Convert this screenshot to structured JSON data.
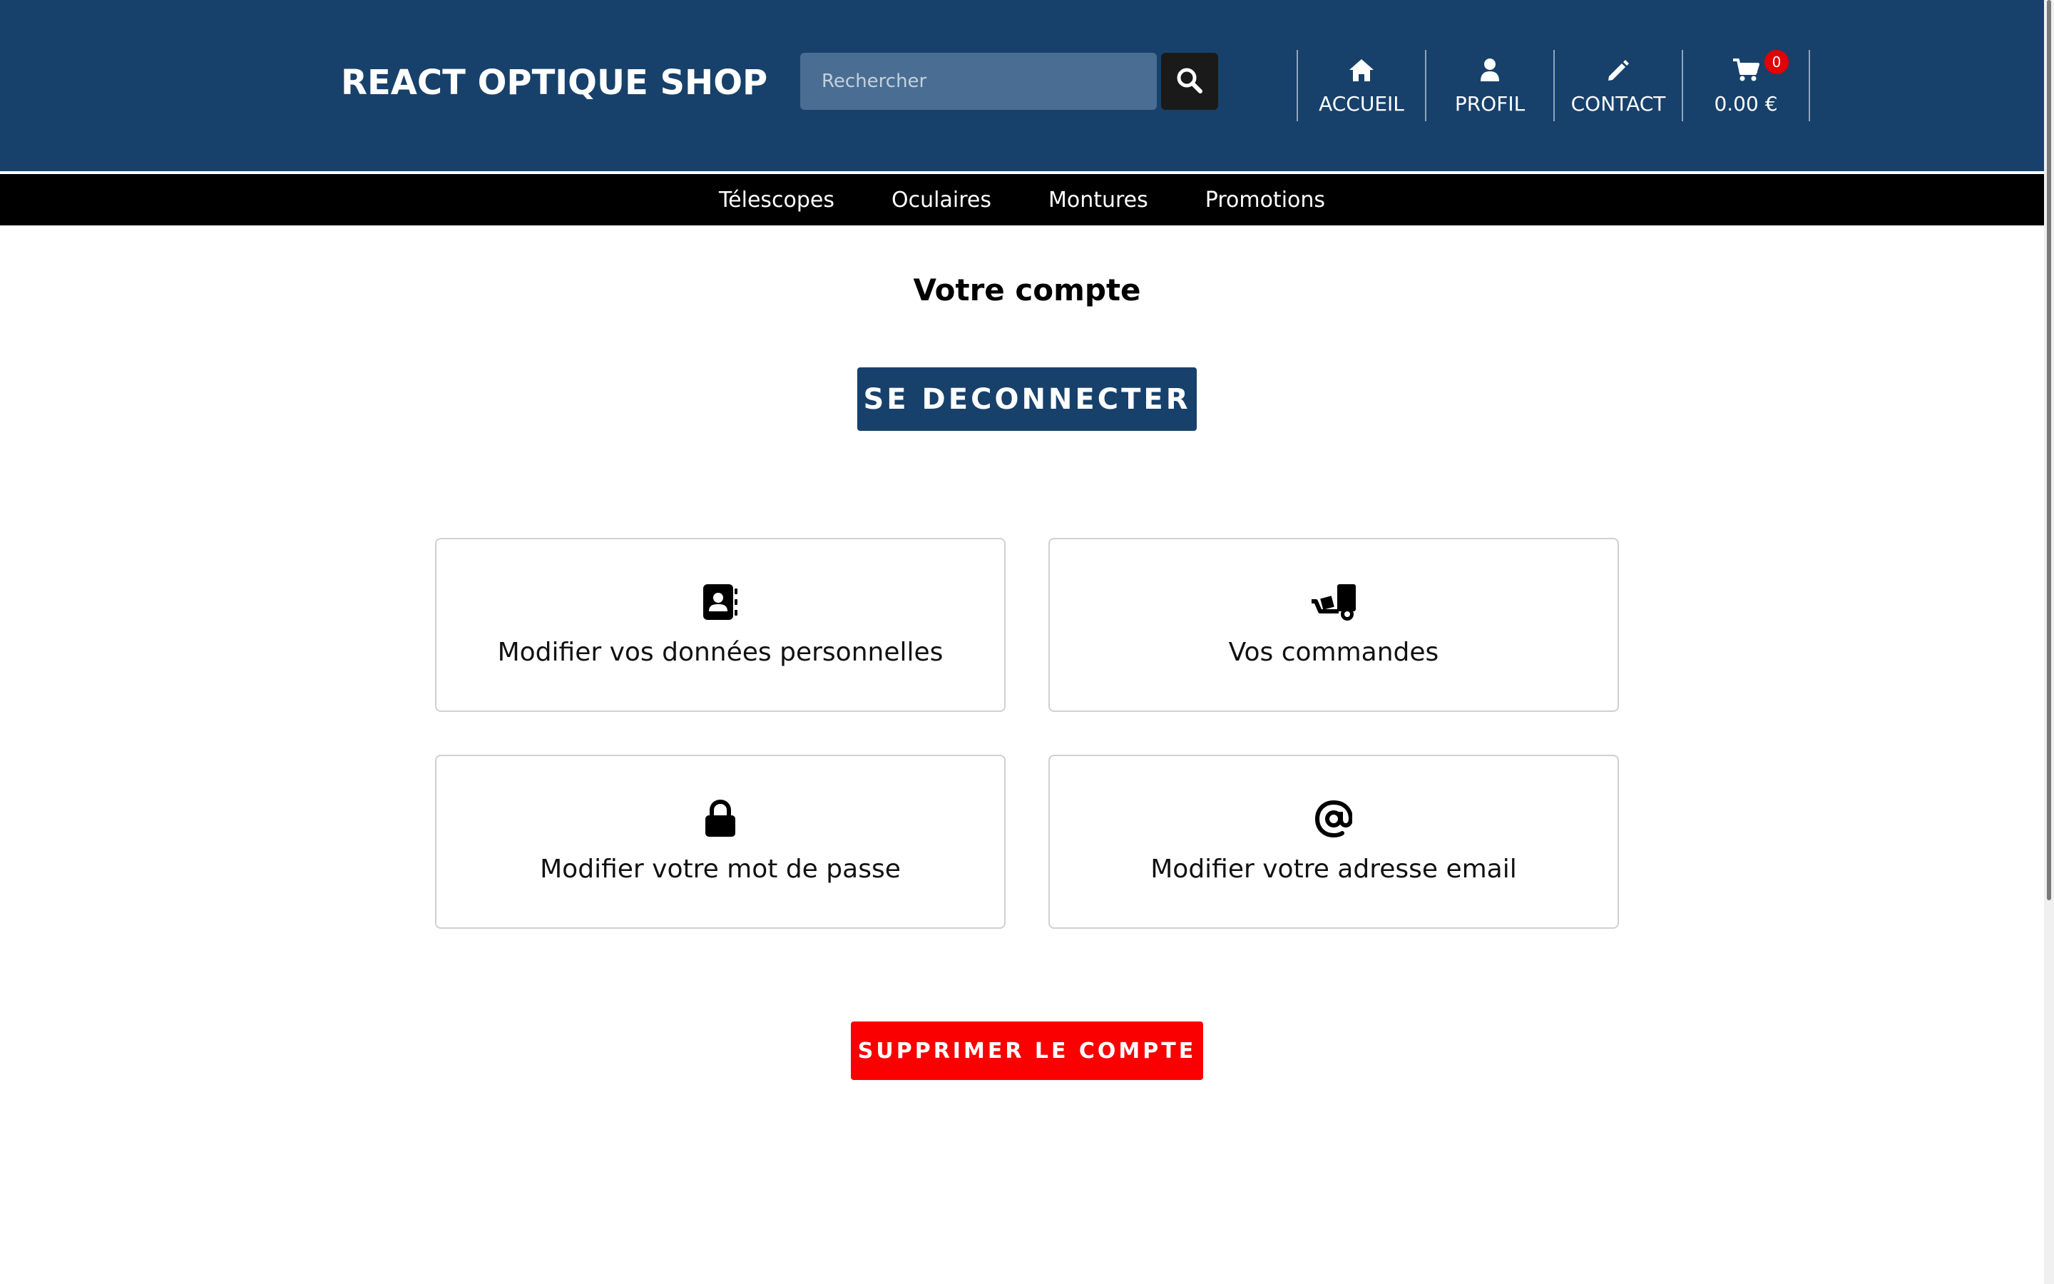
{
  "header": {
    "logo": "REACT OPTIQUE SHOP",
    "search": {
      "placeholder": "Rechercher",
      "value": ""
    },
    "nav": [
      {
        "label": "ACCUEIL",
        "icon": "home-icon"
      },
      {
        "label": "PROFIL",
        "icon": "user-icon"
      },
      {
        "label": "CONTACT",
        "icon": "pencil-icon"
      },
      {
        "label": "0.00 €",
        "icon": "cart-icon",
        "badge": "0"
      }
    ],
    "colors": {
      "background": "#17416b",
      "badge": "#e30000"
    }
  },
  "categories": [
    "Télescopes",
    "Oculaires",
    "Montures",
    "Promotions"
  ],
  "main": {
    "title": "Votre compte",
    "logout_label": "SE DECONNECTER",
    "cards": [
      {
        "label": "Modifier vos données personnelles",
        "icon": "address-book-icon"
      },
      {
        "label": "Vos commandes",
        "icon": "dolly-icon"
      },
      {
        "label": "Modifier votre mot de passe",
        "icon": "lock-icon"
      },
      {
        "label": "Modifier votre adresse email",
        "icon": "at-icon"
      }
    ],
    "delete_label": "SUPPRIMER LE COMPTE",
    "colors": {
      "primary": "#17416b",
      "danger": "#fb0000"
    }
  }
}
